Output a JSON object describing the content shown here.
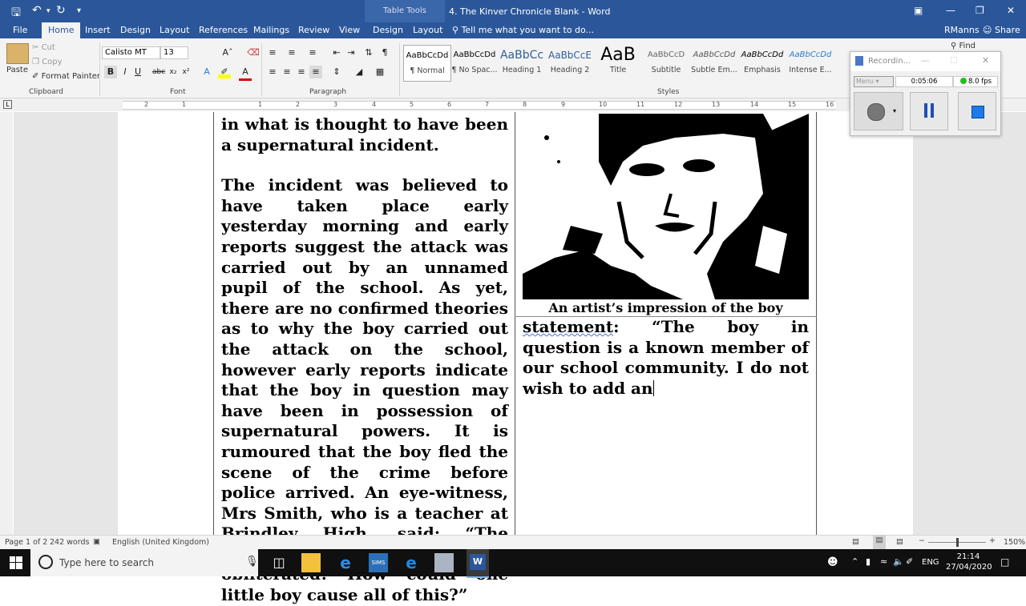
{
  "titlebar": {
    "table_tools": "Table Tools",
    "doc_title": "4. The Kinver Chronicle Blank  -  Word"
  },
  "tabs": [
    "File",
    "Home",
    "Insert",
    "Design",
    "Layout",
    "References",
    "Mailings",
    "Review",
    "View",
    "Design",
    "Layout"
  ],
  "tell_me": "Tell me what you want to do...",
  "user": "RManns",
  "share": "Share",
  "clipboard": {
    "paste": "Paste",
    "cut": "Cut",
    "copy": "Copy",
    "format_painter": "Format Painter",
    "label": "Clipboard"
  },
  "font": {
    "name": "Calisto MT",
    "size": "13",
    "label": "Font"
  },
  "paragraph": {
    "label": "Paragraph"
  },
  "styles": {
    "label": "Styles",
    "items": [
      {
        "preview": "AaBbCcDd",
        "name": "¶ Normal"
      },
      {
        "preview": "AaBbCcDd",
        "name": "¶ No Spac..."
      },
      {
        "preview": "AaBbCc",
        "name": "Heading 1"
      },
      {
        "preview": "AaBbCcE",
        "name": "Heading 2"
      },
      {
        "preview": "AaB",
        "name": "Title"
      },
      {
        "preview": "AaBbCcD",
        "name": "Subtitle"
      },
      {
        "preview": "AaBbCcDd",
        "name": "Subtle Em..."
      },
      {
        "preview": "AaBbCcDd",
        "name": "Emphasis"
      },
      {
        "preview": "AaBbCcDd",
        "name": "Intense E..."
      }
    ]
  },
  "find": "Find",
  "recorder": {
    "title": "Recordin...",
    "menu": "Menu",
    "time": "0:05:06",
    "fps": "8.0 fps"
  },
  "ruler_numbers": [
    "2",
    "1",
    "1",
    "2",
    "3",
    "4",
    "5",
    "6",
    "7",
    "8",
    "9",
    "10",
    "11",
    "12",
    "13",
    "14",
    "15",
    "16"
  ],
  "document": {
    "left_top": "in what is thought to have been a supernatural incident.",
    "left_main": "The incident was believed to have taken place early yesterday morning and early reports suggest the attack was carried out by an unnamed pupil of the school. As yet, there are no confirmed theories as to why the boy carried out the attack on the school, however early reports indicate that the boy in question may have been in possession of supernatural powers. It is rumoured that the boy fled the scene of the crime before police arrived. An eye-witness, Mrs Smith, who is a teacher at Brindley High, said: “The school is destroyed – absolutely obliterated! How could one little boy cause all of this?”",
    "caption": "An artist’s impression of the boy",
    "right_word": "statement",
    "right_rest": ": “The boy in question is a known member of our school community. I do not wish to add an"
  },
  "status": {
    "page": "Page 1 of 2",
    "words": "242 words",
    "language": "English (United Kingdom)",
    "zoom": "150%"
  },
  "taskbar": {
    "search": "Type here to search",
    "lang": "ENG",
    "time": "21:14",
    "date": "27/04/2020",
    "sims": "SIMS"
  },
  "colors": {
    "word_blue": "#2b579a",
    "taskbar": "#101010"
  }
}
